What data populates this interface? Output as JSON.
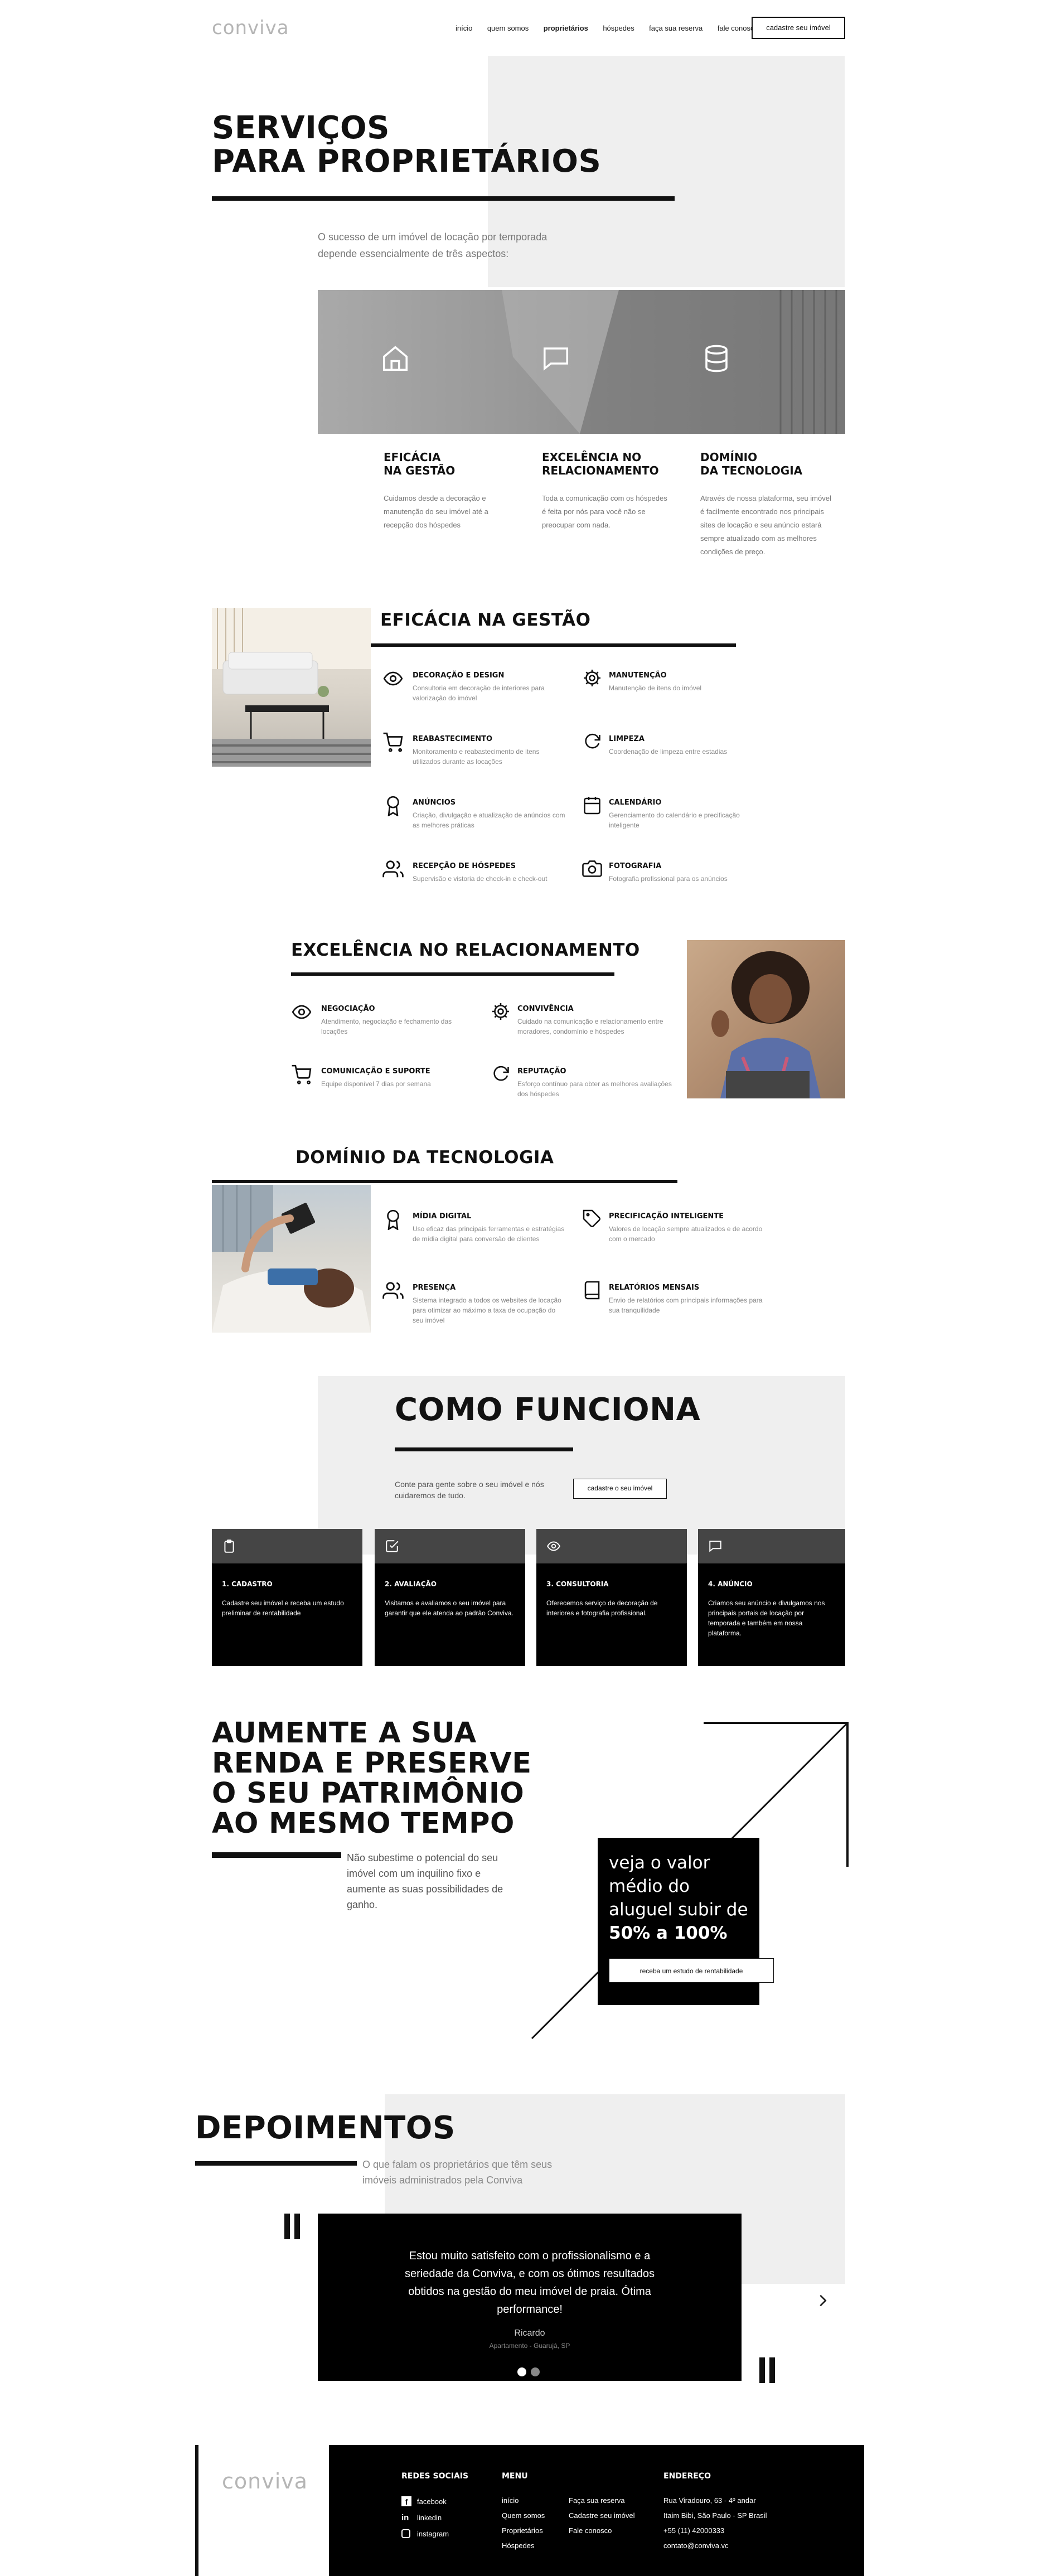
{
  "brand": {
    "logo": "conviva"
  },
  "nav": {
    "items": [
      "início",
      "quem somos",
      "proprietários",
      "hóspedes",
      "faça sua reserva",
      "fale conosco"
    ],
    "cta": "cadastre seu imóvel"
  },
  "hero": {
    "title_line1": "SERVIÇOS",
    "title_line2": "PARA PROPRIETÁRIOS",
    "intro": "O sucesso de um imóvel de locação por temporada depende essencialmente de três aspectos:"
  },
  "pillars": [
    {
      "icon": "home-icon",
      "title": "EFICÁCIA\nNA GESTÃO",
      "desc": "Cuidamos desde a decoração e manutenção do seu imóvel até a recepção dos hóspedes"
    },
    {
      "icon": "chat-icon",
      "title": "EXCELÊNCIA NO\nRELACIONAMENTO",
      "desc": "Toda a comunicação com os hóspedes é feita por nós para você não se preocupar com nada."
    },
    {
      "icon": "database-icon",
      "title": "DOMÍNIO\nDA TECNOLOGIA",
      "desc": "Através de nossa plataforma, seu imóvel é facilmente encontrado nos principais sites de locação e seu anúncio estará sempre atualizado com as melhores condições de preço."
    }
  ],
  "gestao": {
    "title": "EFICÁCIA NA GESTÃO",
    "items": [
      {
        "icon": "eye-icon",
        "title": "DECORAÇÃO E DESIGN",
        "desc": "Consultoria em decoração de interiores para valorização do imóvel"
      },
      {
        "icon": "gear-icon",
        "title": "MANUTENÇÃO",
        "desc": "Manutenção de itens do imóvel"
      },
      {
        "icon": "cart-icon",
        "title": "REABASTECIMENTO",
        "desc": "Monitoramento e reabastecimento de itens utilizados durante as locações"
      },
      {
        "icon": "refresh-icon",
        "title": "LIMPEZA",
        "desc": "Coordenação de limpeza entre estadias"
      },
      {
        "icon": "award-icon",
        "title": "ANÚNCIOS",
        "desc": "Criação, divulgação e atualização de anúncios com as melhores práticas"
      },
      {
        "icon": "calendar-icon",
        "title": "CALENDÁRIO",
        "desc": "Gerenciamento do calendário e precificação inteligente"
      },
      {
        "icon": "users-icon",
        "title": "RECEPÇÃO DE HÓSPEDES",
        "desc": "Supervisão e vistoria de check-in e check-out"
      },
      {
        "icon": "camera-icon",
        "title": "FOTOGRAFIA",
        "desc": "Fotografia profissional para os anúncios"
      }
    ]
  },
  "relacionamento": {
    "title": "EXCELÊNCIA NO RELACIONAMENTO",
    "items": [
      {
        "icon": "eye-icon",
        "title": "NEGOCIAÇÃO",
        "desc": "Atendimento, negociação e fechamento das locações"
      },
      {
        "icon": "gear-icon",
        "title": "CONVIVÊNCIA",
        "desc": "Cuidado na comunicação e relacionamento entre moradores, condomínio e hóspedes"
      },
      {
        "icon": "cart-icon",
        "title": "COMUNICAÇÃO E SUPORTE",
        "desc": "Equipe disponível 7 dias por semana"
      },
      {
        "icon": "refresh-icon",
        "title": "REPUTAÇÃO",
        "desc": "Esforço contínuo para obter as melhores avaliações dos hóspedes"
      }
    ]
  },
  "tecnologia": {
    "title": "DOMÍNIO DA TECNOLOGIA",
    "items": [
      {
        "icon": "award-icon",
        "title": "MÍDIA DIGITAL",
        "desc": "Uso eficaz das principais ferramentas e estratégias de mídia digital para conversão de clientes"
      },
      {
        "icon": "tag-icon",
        "title": "PRECIFICAÇÃO INTELIGENTE",
        "desc": "Valores de locação sempre atualizados e de acordo com o mercado"
      },
      {
        "icon": "users-icon",
        "title": "PRESENÇA",
        "desc": "Sistema integrado a todos os websites de locação para otimizar ao máximo a taxa de ocupação do seu imóvel"
      },
      {
        "icon": "book-icon",
        "title": "RELATÓRIOS MENSAIS",
        "desc": "Envio de relatórios com principais informações para sua tranquilidade"
      }
    ]
  },
  "como": {
    "title": "COMO FUNCIONA",
    "text": "Conte para gente sobre o seu imóvel e nós cuidaremos de tudo.",
    "cta": "cadastre o seu imóvel",
    "steps": [
      {
        "icon": "clipboard-icon",
        "title": "1. CADASTRO",
        "desc": "Cadastre seu imóvel e receba um estudo preliminar de rentabilidade"
      },
      {
        "icon": "check-square-icon",
        "title": "2. AVALIAÇÃO",
        "desc": "Visitamos e avaliamos o seu imóvel para garantir que ele atenda ao padrão Conviva."
      },
      {
        "icon": "eye-icon",
        "title": "3. CONSULTORIA",
        "desc": "Oferecemos serviço de decoração de interiores e fotografia profissional."
      },
      {
        "icon": "chat-icon",
        "title": "4. ANÚNCIO",
        "desc": "Criamos seu anúncio e divulgamos nos principais portais de locação por temporada e também em nossa plataforma."
      }
    ]
  },
  "renda": {
    "title_lines": [
      "AUMENTE A SUA",
      "RENDA E PRESERVE",
      "O SEU PATRIMÔNIO",
      "AO MESMO TEMPO"
    ],
    "text": "Não subestime o potencial do seu imóvel com um inquilino fixo e aumente as suas possibilidades de ganho.",
    "box_text": "veja o valor médio do aluguel subir de",
    "box_highlight": "50% a 100%",
    "box_cta": "receba um estudo de rentabilidade"
  },
  "depoimentos": {
    "title": "DEPOIMENTOS",
    "subtitle": "O que falam os proprietários que têm seus imóveis administrados pela Conviva",
    "quote": "Estou muito satisfeito com o profissionalismo e a seriedade da Conviva, e com os ótimos resultados obtidos na gestão do meu imóvel de praia. Ótima performance!",
    "author": "Ricardo",
    "location": "Apartamento - Guarujá, SP"
  },
  "footer": {
    "logo": "conviva",
    "social_title": "REDES SOCIAIS",
    "social": [
      {
        "icon": "facebook-icon",
        "label": "facebook"
      },
      {
        "icon": "linkedin-icon",
        "label": "linkedin"
      },
      {
        "icon": "instagram-icon",
        "label": "instagram"
      }
    ],
    "menu_title": "MENU",
    "menu_col1": [
      "início",
      "Quem somos",
      "Proprietários",
      "Hóspedes"
    ],
    "menu_col2": [
      "Faça sua reserva",
      "Cadastre seu imóvel",
      "Fale conosco"
    ],
    "address_title": "ENDEREÇO",
    "address_lines": [
      "Rua Viradouro, 63 - 4º andar",
      "Itaim Bibi, São Paulo - SP Brasil",
      "+55 (11) 42000333",
      "contato@conviva.vc"
    ]
  },
  "colors": {
    "dark": "#000000",
    "step_top": "#454545",
    "light_gray": "#efefef",
    "text_gray": "#8a8a8a"
  }
}
